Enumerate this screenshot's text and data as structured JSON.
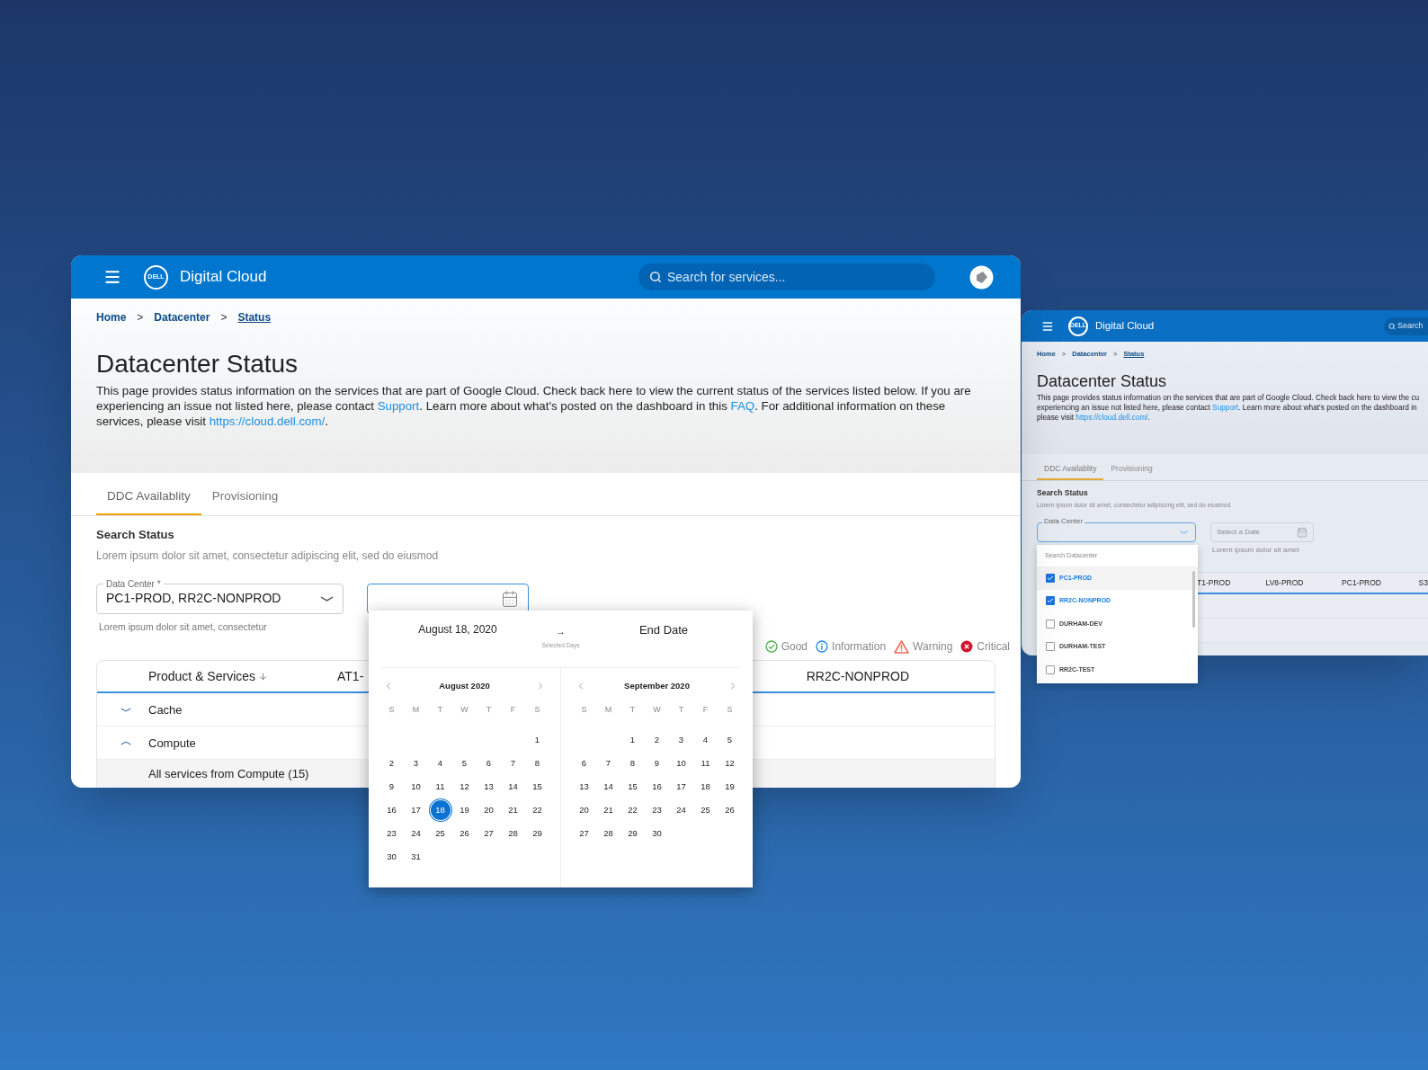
{
  "main_window": {
    "logo_text": "DELL",
    "app_title": "Digital Cloud",
    "search": {
      "placeholder": "Search for services..."
    },
    "breadcrumb": [
      {
        "label": "Home",
        "current": false,
        "separator": ">"
      },
      {
        "label": "Datacenter",
        "current": false,
        "separator": ">"
      },
      {
        "label": "Status",
        "current": true
      }
    ],
    "title": "Datacenter Status",
    "intro": [
      {
        "text": "This page provides status information on the services that are part of Google Cloud. Check back here to view the current status of the services listed below. If you are experiencing an issue not listed here, please contact ",
        "link": false
      },
      {
        "text": "Support",
        "link": true
      },
      {
        "text": ". Learn more about what's posted on the dashboard in this ",
        "link": false
      },
      {
        "text": "FAQ",
        "link": true
      },
      {
        "text": ". For additional information on these services, please visit ",
        "link": false
      },
      {
        "text": "https://cloud.dell.com/",
        "link": true
      },
      {
        "text": ".",
        "link": false
      }
    ],
    "tabs": [
      {
        "label": "DDC Availablity",
        "selected": true
      },
      {
        "label": "Provisioning",
        "selected": false
      }
    ],
    "search_status": {
      "heading": "Search Status",
      "description": "Lorem ipsum dolor sit amet, consectetur adipiscing elit, sed do eiusmod"
    },
    "data_center": {
      "label": "Data Center *",
      "value": "PC1-PROD, RR2C-NONPROD",
      "helper": "Lorem ipsum dolor sit amet, consectetur"
    },
    "date_field": {
      "focused": true
    },
    "legend": [
      {
        "kind": "good",
        "label": "Good",
        "color": "#4caf50"
      },
      {
        "kind": "info",
        "label": "Information",
        "color": "#1e88e5"
      },
      {
        "kind": "warning",
        "label": "Warning",
        "color": "#f26b5b"
      },
      {
        "kind": "critical",
        "label": "Critical",
        "color": "#d0142c"
      }
    ],
    "table": {
      "columns": [
        {
          "label": "Product & Services",
          "sorted": true
        },
        {
          "label": "AT1-",
          "sorted": false
        },
        {
          "label": "RR2C-NONPROD",
          "sorted": false
        }
      ],
      "rows": [
        {
          "label": "Cache",
          "expanded": false
        },
        {
          "label": "Compute",
          "expanded": true,
          "children": [
            {
              "label": "All services from Compute (15)"
            }
          ]
        }
      ]
    }
  },
  "date_picker": {
    "start": "August 18, 2020",
    "arrow": "→",
    "caption": "Selected Days",
    "end": "End Date",
    "months": [
      {
        "title": "August 2020",
        "weekdays": [
          "S",
          "M",
          "T",
          "W",
          "T",
          "F",
          "S"
        ],
        "weeks": [
          [
            {
              "day": "1",
              "selected": false
            }
          ],
          [
            {
              "day": "2",
              "selected": false
            },
            {
              "day": "3",
              "selected": false
            },
            {
              "day": "4",
              "selected": false
            },
            {
              "day": "5",
              "selected": false
            },
            {
              "day": "6",
              "selected": false
            },
            {
              "day": "7",
              "selected": false
            },
            {
              "day": "8",
              "selected": false
            }
          ],
          [
            {
              "day": "9",
              "selected": false
            },
            {
              "day": "10",
              "selected": false
            },
            {
              "day": "11",
              "selected": false
            },
            {
              "day": "12",
              "selected": false
            },
            {
              "day": "13",
              "selected": false
            },
            {
              "day": "14",
              "selected": false
            },
            {
              "day": "15",
              "selected": false
            }
          ],
          [
            {
              "day": "16",
              "selected": false
            },
            {
              "day": "17",
              "selected": false
            },
            {
              "day": "18",
              "selected": true
            },
            {
              "day": "19",
              "selected": false
            },
            {
              "day": "20",
              "selected": false
            },
            {
              "day": "21",
              "selected": false
            },
            {
              "day": "22",
              "selected": false
            }
          ],
          [
            {
              "day": "23",
              "selected": false
            },
            {
              "day": "24",
              "selected": false
            },
            {
              "day": "25",
              "selected": false
            },
            {
              "day": "26",
              "selected": false
            },
            {
              "day": "27",
              "selected": false
            },
            {
              "day": "28",
              "selected": false
            },
            {
              "day": "29",
              "selected": false
            }
          ],
          [
            {
              "day": "30",
              "selected": false
            },
            {
              "day": "31",
              "selected": false
            }
          ]
        ]
      },
      {
        "title": "September 2020",
        "weekdays": [
          "S",
          "M",
          "T",
          "W",
          "T",
          "F",
          "S"
        ],
        "weeks": [
          [
            {
              "day": "1",
              "selected": false
            },
            {
              "day": "2",
              "selected": false
            },
            {
              "day": "3",
              "selected": false
            },
            {
              "day": "4",
              "selected": false
            },
            {
              "day": "5",
              "selected": false
            }
          ],
          [
            {
              "day": "6",
              "selected": false
            },
            {
              "day": "7",
              "selected": false
            },
            {
              "day": "8",
              "selected": false
            },
            {
              "day": "9",
              "selected": false
            },
            {
              "day": "10",
              "selected": false
            },
            {
              "day": "11",
              "selected": false
            },
            {
              "day": "12",
              "selected": false
            }
          ],
          [
            {
              "day": "13",
              "selected": false
            },
            {
              "day": "14",
              "selected": false
            },
            {
              "day": "15",
              "selected": false
            },
            {
              "day": "16",
              "selected": false
            },
            {
              "day": "17",
              "selected": false
            },
            {
              "day": "18",
              "selected": false
            },
            {
              "day": "19",
              "selected": false
            }
          ],
          [
            {
              "day": "20",
              "selected": false
            },
            {
              "day": "21",
              "selected": false
            },
            {
              "day": "22",
              "selected": false
            },
            {
              "day": "23",
              "selected": false
            },
            {
              "day": "24",
              "selected": false
            },
            {
              "day": "25",
              "selected": false
            },
            {
              "day": "26",
              "selected": false
            }
          ],
          [
            {
              "day": "27",
              "selected": false
            },
            {
              "day": "28",
              "selected": false
            },
            {
              "day": "29",
              "selected": false
            },
            {
              "day": "30",
              "selected": false
            }
          ]
        ]
      }
    ]
  },
  "window_2": {
    "logo_text": "DELL",
    "app_title": "Digital Cloud",
    "search": {
      "placeholder": "Search"
    },
    "breadcrumb": [
      {
        "label": "Home",
        "current": false,
        "separator": ">"
      },
      {
        "label": "Datacenter",
        "current": false,
        "separator": ">"
      },
      {
        "label": "Status",
        "current": true
      }
    ],
    "title": "Datacenter Status",
    "intro_lines": [
      [
        {
          "text": "This page provides status information on the services that are part of Google Cloud. Check back here to view the cu",
          "link": false
        }
      ],
      [
        {
          "text": "experiencing an issue not listed here, please contact ",
          "link": false
        },
        {
          "text": "Support",
          "link": true
        },
        {
          "text": ". Learn more about what's posted on the dashboard in",
          "link": false
        }
      ],
      [
        {
          "text": "please visit ",
          "link": false
        },
        {
          "text": "https://cloud.dell.com/",
          "link": true
        },
        {
          "text": "."
        }
      ]
    ],
    "tabs": [
      {
        "label": "DDC Availablity",
        "selected": true
      },
      {
        "label": "Provisioning",
        "selected": false
      }
    ],
    "search_status": {
      "heading": "Search Status",
      "description": "Lorem ipsum dolor sit amet, consectetur adipiscing elit, sed do eiusmod"
    },
    "data_center": {
      "label": "Data Center"
    },
    "date_field": {
      "placeholder": "Select a Date",
      "helper": "Lorem ipsum dolor sit amet"
    },
    "table": {
      "columns": [
        "T1-PROD",
        "LV8-PROD",
        "PC1-PROD",
        "S3"
      ]
    },
    "dropdown": {
      "search_placeholder": "Search Datacenter",
      "options": [
        {
          "label": "PC1-PROD",
          "checked": true,
          "selected": true
        },
        {
          "label": "RR2C-NONPROD",
          "checked": true,
          "selected": false
        },
        {
          "label": "DURHAM-DEV",
          "checked": false,
          "selected": false
        },
        {
          "label": "DURHAM-TEST",
          "checked": false,
          "selected": false
        },
        {
          "label": "RR2C-TEST",
          "checked": false,
          "selected": false
        }
      ]
    }
  }
}
